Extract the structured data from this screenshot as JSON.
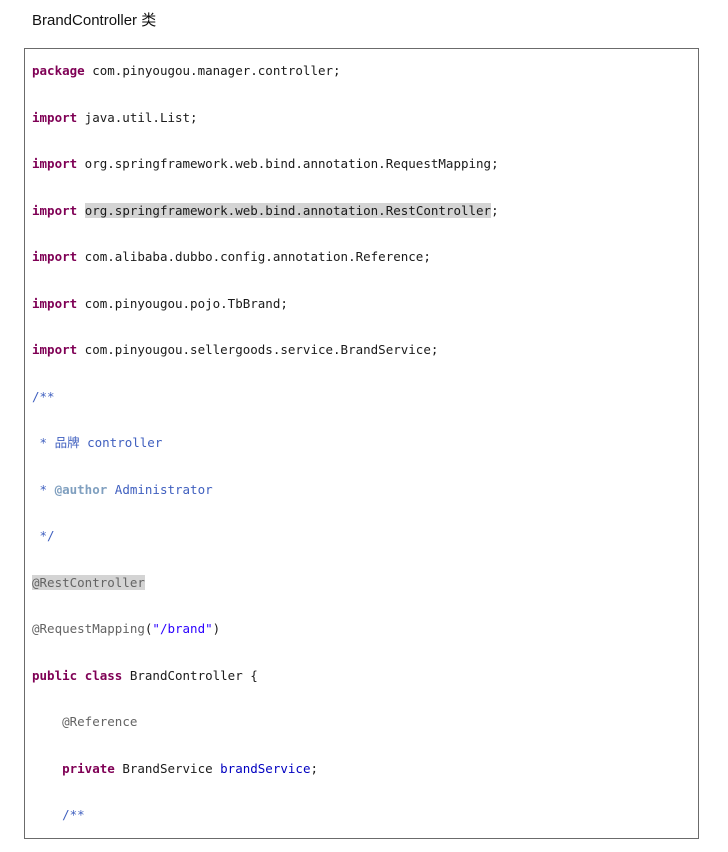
{
  "document": {
    "title": "BrandController 类"
  },
  "code": {
    "lines": [
      [
        {
          "t": "kw",
          "v": "package"
        },
        {
          "t": "plain",
          "v": " com.pinyougou.manager.controller;"
        }
      ],
      [
        {
          "t": "kw",
          "v": "import"
        },
        {
          "t": "plain",
          "v": " java.util.List;"
        }
      ],
      [
        {
          "t": "kw",
          "v": "import"
        },
        {
          "t": "plain",
          "v": " org.springframework.web.bind.annotation.RequestMapping;"
        }
      ],
      [
        {
          "t": "kw",
          "v": "import"
        },
        {
          "t": "plain",
          "v": " "
        },
        {
          "t": "plain",
          "v": "org.springframework.web.bind.annotation.RestController",
          "hl": true
        },
        {
          "t": "plain",
          "v": ";"
        }
      ],
      [
        {
          "t": "kw",
          "v": "import"
        },
        {
          "t": "plain",
          "v": " com.alibaba.dubbo.config.annotation.Reference;"
        }
      ],
      [
        {
          "t": "kw",
          "v": "import"
        },
        {
          "t": "plain",
          "v": " com.pinyougou.pojo.TbBrand;"
        }
      ],
      [
        {
          "t": "kw",
          "v": "import"
        },
        {
          "t": "plain",
          "v": " com.pinyougou.sellergoods.service.BrandService;"
        }
      ],
      [
        {
          "t": "comment",
          "v": "/**"
        }
      ],
      [
        {
          "t": "comment",
          "v": " * 品牌 controller"
        }
      ],
      [
        {
          "t": "comment",
          "v": " * "
        },
        {
          "t": "doctag",
          "v": "@author"
        },
        {
          "t": "comment",
          "v": " Administrator"
        }
      ],
      [
        {
          "t": "comment",
          "v": " */"
        }
      ],
      [
        {
          "t": "anno",
          "v": "@RestController",
          "hl": true
        }
      ],
      [
        {
          "t": "anno",
          "v": "@RequestMapping"
        },
        {
          "t": "plain",
          "v": "("
        },
        {
          "t": "string",
          "v": "\"/brand\""
        },
        {
          "t": "plain",
          "v": ")"
        }
      ],
      [
        {
          "t": "kw",
          "v": "public"
        },
        {
          "t": "plain",
          "v": " "
        },
        {
          "t": "kw",
          "v": "class"
        },
        {
          "t": "plain",
          "v": " BrandController {"
        }
      ],
      [
        {
          "t": "plain",
          "v": "    "
        },
        {
          "t": "anno",
          "v": "@Reference"
        }
      ],
      [
        {
          "t": "plain",
          "v": "    "
        },
        {
          "t": "kw",
          "v": "private"
        },
        {
          "t": "plain",
          "v": " BrandService "
        },
        {
          "t": "field",
          "v": "brandService"
        },
        {
          "t": "plain",
          "v": ";"
        }
      ],
      [
        {
          "t": "plain",
          "v": "    "
        },
        {
          "t": "comment",
          "v": "/**"
        }
      ]
    ]
  },
  "colors": {
    "keyword": "#7f0055",
    "comment": "#3f5fbf",
    "doc_tag": "#7f9fbf",
    "annotation": "#646464",
    "string": "#2a00ff",
    "field": "#0000c0",
    "highlight": "#d4d4d4",
    "border": "#6b6b6b"
  }
}
